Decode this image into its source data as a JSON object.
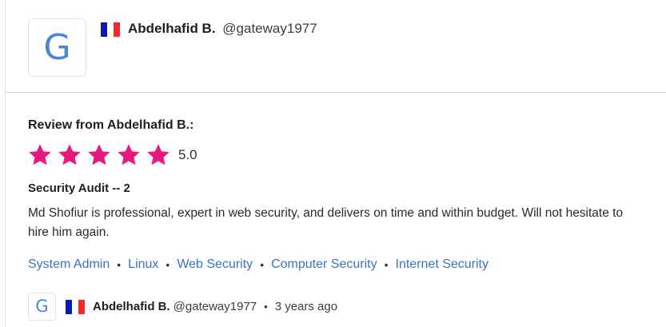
{
  "header": {
    "avatar_letter": "G",
    "flag": "france-flag",
    "name": "Abdelhafid B.",
    "handle": "@gateway1977"
  },
  "review": {
    "title": "Review from Abdelhafid B.:",
    "rating": 5.0,
    "rating_text": "5.0",
    "star_color": "#e8197d",
    "project_title": "Security Audit -- 2",
    "text": "Md Shofiur is professional, expert in web security, and delivers on time and within budget. Will not hesitate to hire him again.",
    "skills": [
      "System Admin",
      "Linux",
      "Web Security",
      "Computer Security",
      "Internet Security"
    ]
  },
  "footer": {
    "avatar_letter": "G",
    "flag": "france-flag",
    "name": "Abdelhafid B.",
    "handle": "@gateway1977",
    "time": "3 years ago"
  },
  "colors": {
    "link": "#3973c7",
    "avatar_letter": "#4a86d6",
    "star": "#e8197d"
  }
}
